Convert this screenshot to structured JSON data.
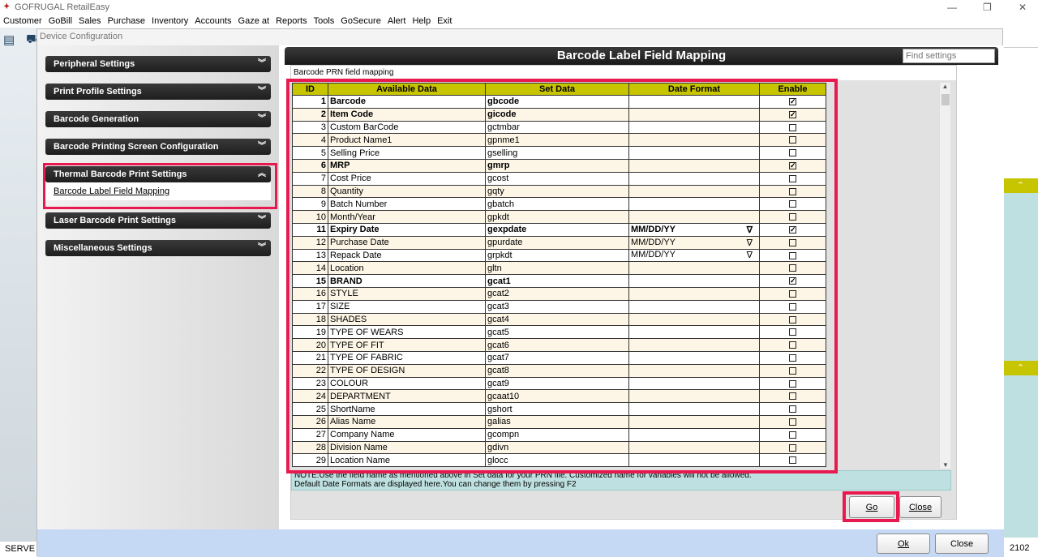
{
  "app": {
    "title": "GOFRUGAL RetailEasy",
    "status_left": "SERVE |",
    "status_right": "2102"
  },
  "menu": [
    "Customer",
    "GoBill",
    "Sales",
    "Purchase",
    "Inventory",
    "Accounts",
    "Gaze at",
    "Reports",
    "Tools",
    "GoSecure",
    "Alert",
    "Help",
    "Exit"
  ],
  "dialog": {
    "title": "Device Configuration",
    "ok": "Ok",
    "close": "Close"
  },
  "sidebar": {
    "items": [
      {
        "label": "Peripheral Settings",
        "state": "collapsed"
      },
      {
        "label": "Print Profile Settings",
        "state": "collapsed"
      },
      {
        "label": "Barcode Generation",
        "state": "collapsed"
      },
      {
        "label": "Barcode Printing Screen Configuration",
        "state": "collapsed"
      },
      {
        "label": "Thermal Barcode Print Settings",
        "state": "expanded",
        "sub": "Barcode Label Field Mapping"
      },
      {
        "label": "Laser Barcode Print Settings",
        "state": "collapsed"
      },
      {
        "label": "Miscellaneous Settings",
        "state": "collapsed"
      }
    ]
  },
  "main": {
    "header": "Barcode Label Field Mapping",
    "find_placeholder": "Find settings",
    "subtitle": "Barcode PRN field mapping",
    "columns": [
      "ID",
      "Available Data",
      "Set Data",
      "Date Format",
      "Enable"
    ],
    "rows": [
      {
        "id": "1",
        "name": "Barcode",
        "set": "gbcode",
        "fmt": "",
        "en": true
      },
      {
        "id": "2",
        "name": "Item Code",
        "set": "gicode",
        "fmt": "",
        "en": true
      },
      {
        "id": "3",
        "name": "Custom BarCode",
        "set": "gctmbar",
        "fmt": "",
        "en": false
      },
      {
        "id": "4",
        "name": "Product Name1",
        "set": "gpnme1",
        "fmt": "",
        "en": false
      },
      {
        "id": "5",
        "name": "Selling Price",
        "set": "gselling",
        "fmt": "",
        "en": false
      },
      {
        "id": "6",
        "name": "MRP",
        "set": "gmrp",
        "fmt": "",
        "en": true
      },
      {
        "id": "7",
        "name": "Cost Price",
        "set": "gcost",
        "fmt": "",
        "en": false
      },
      {
        "id": "8",
        "name": "Quantity",
        "set": "gqty",
        "fmt": "",
        "en": false
      },
      {
        "id": "9",
        "name": "Batch Number",
        "set": "gbatch",
        "fmt": "",
        "en": false
      },
      {
        "id": "10",
        "name": "Month/Year",
        "set": "gpkdt",
        "fmt": "",
        "en": false
      },
      {
        "id": "11",
        "name": "Expiry Date",
        "set": "gexpdate",
        "fmt": "MM/DD/YY",
        "en": true
      },
      {
        "id": "12",
        "name": "Purchase Date",
        "set": "gpurdate",
        "fmt": "MM/DD/YY",
        "en": false
      },
      {
        "id": "13",
        "name": "Repack Date",
        "set": "grpkdt",
        "fmt": "MM/DD/YY",
        "en": false
      },
      {
        "id": "14",
        "name": "Location",
        "set": "gltn",
        "fmt": "",
        "en": false
      },
      {
        "id": "15",
        "name": "BRAND",
        "set": "gcat1",
        "fmt": "",
        "en": true
      },
      {
        "id": "16",
        "name": "STYLE",
        "set": "gcat2",
        "fmt": "",
        "en": false
      },
      {
        "id": "17",
        "name": "SIZE",
        "set": "gcat3",
        "fmt": "",
        "en": false
      },
      {
        "id": "18",
        "name": "SHADES",
        "set": "gcat4",
        "fmt": "",
        "en": false
      },
      {
        "id": "19",
        "name": "TYPE OF WEARS",
        "set": "gcat5",
        "fmt": "",
        "en": false
      },
      {
        "id": "20",
        "name": "TYPE OF FIT",
        "set": "gcat6",
        "fmt": "",
        "en": false
      },
      {
        "id": "21",
        "name": "TYPE OF FABRIC",
        "set": "gcat7",
        "fmt": "",
        "en": false
      },
      {
        "id": "22",
        "name": "TYPE OF DESIGN",
        "set": "gcat8",
        "fmt": "",
        "en": false
      },
      {
        "id": "23",
        "name": "COLOUR",
        "set": "gcat9",
        "fmt": "",
        "en": false
      },
      {
        "id": "24",
        "name": "DEPARTMENT",
        "set": "gcaat10",
        "fmt": "",
        "en": false
      },
      {
        "id": "25",
        "name": "ShortName",
        "set": "gshort",
        "fmt": "",
        "en": false
      },
      {
        "id": "26",
        "name": "Alias Name",
        "set": "galias",
        "fmt": "",
        "en": false
      },
      {
        "id": "27",
        "name": "Company Name",
        "set": "gcompn",
        "fmt": "",
        "en": false
      },
      {
        "id": "28",
        "name": "Division Name",
        "set": "gdivn",
        "fmt": "",
        "en": false
      },
      {
        "id": "29",
        "name": "Location Name",
        "set": "glocc",
        "fmt": "",
        "en": false
      }
    ],
    "note1": "NOTE:Use the field name as mentioned above in Set data for your PRN file.  Customized name for variables will not be allowed.",
    "note2": "Default Date Formats are displayed here.You can change them by pressing F2",
    "go": "Go",
    "close": "Close"
  },
  "colors": {
    "highlight": "#e8194f",
    "header_olive": "#c7c400",
    "note_bg": "#bfe0e0"
  }
}
